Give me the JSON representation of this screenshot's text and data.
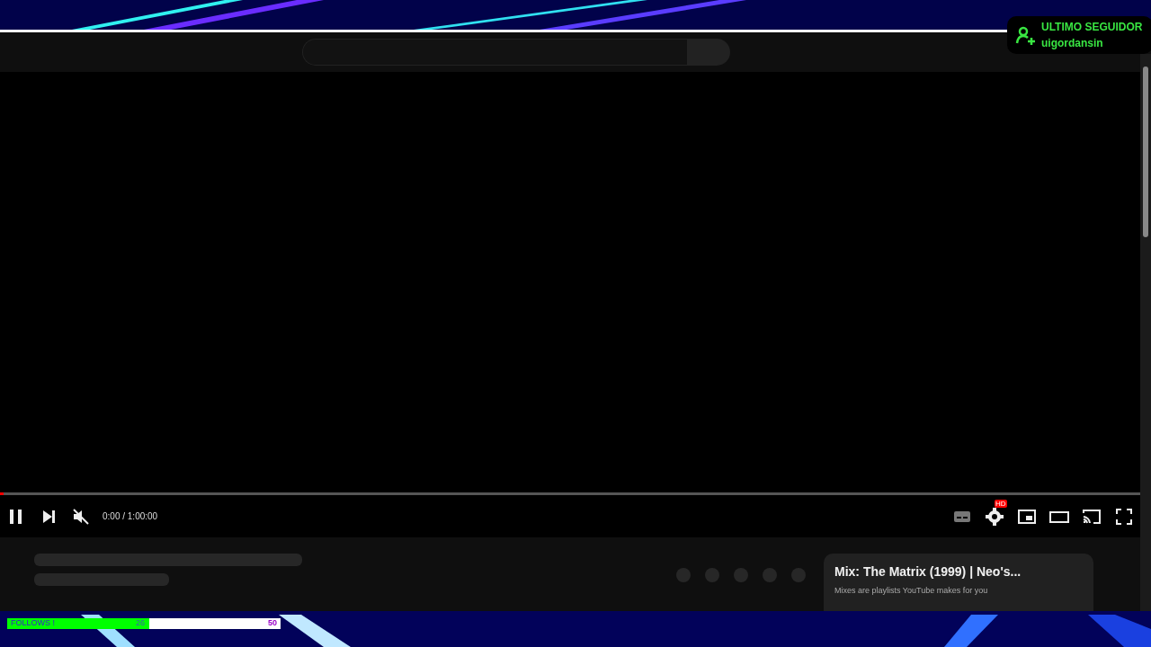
{
  "alert": {
    "title": "ULTIMO SEGUIDOR",
    "username": "uigordansin"
  },
  "player": {
    "playing": true,
    "muted": true,
    "time": "0:00 / 1:00:00",
    "settings_badge": "HD",
    "progress": {
      "level": 0.003
    }
  },
  "mix_card": {
    "title": "Mix: The Matrix (1999) | Neo's...",
    "subtitle": "Mixes are playlists YouTube makes for you"
  },
  "follows": {
    "label": "FOLLOWS !",
    "current": "26",
    "goal": "50",
    "level": 0.52
  }
}
